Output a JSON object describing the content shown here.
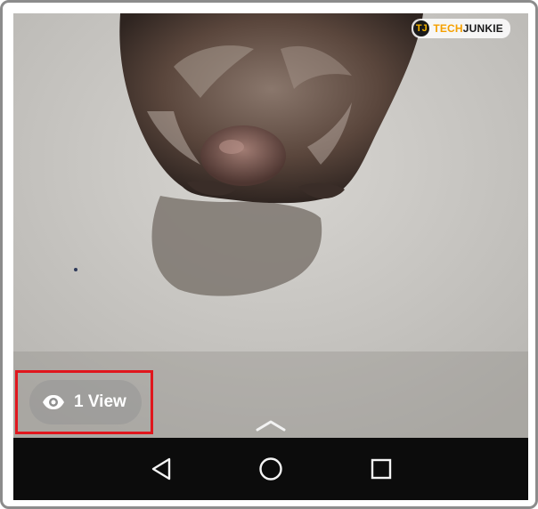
{
  "watermark": {
    "logo_letter": "TJ",
    "brand_prefix": "TECH",
    "brand_suffix": "JUNKIE"
  },
  "story": {
    "view_count_label": "1 View",
    "view_icon": "eye-icon",
    "swipe_icon": "chevron-up-icon"
  },
  "navigation": {
    "back_icon": "back-triangle-icon",
    "home_icon": "home-circle-icon",
    "recent_icon": "recent-apps-square-icon"
  },
  "colors": {
    "highlight": "#e0161d",
    "navbar": "#0c0c0c",
    "accent": "#f5a000"
  }
}
